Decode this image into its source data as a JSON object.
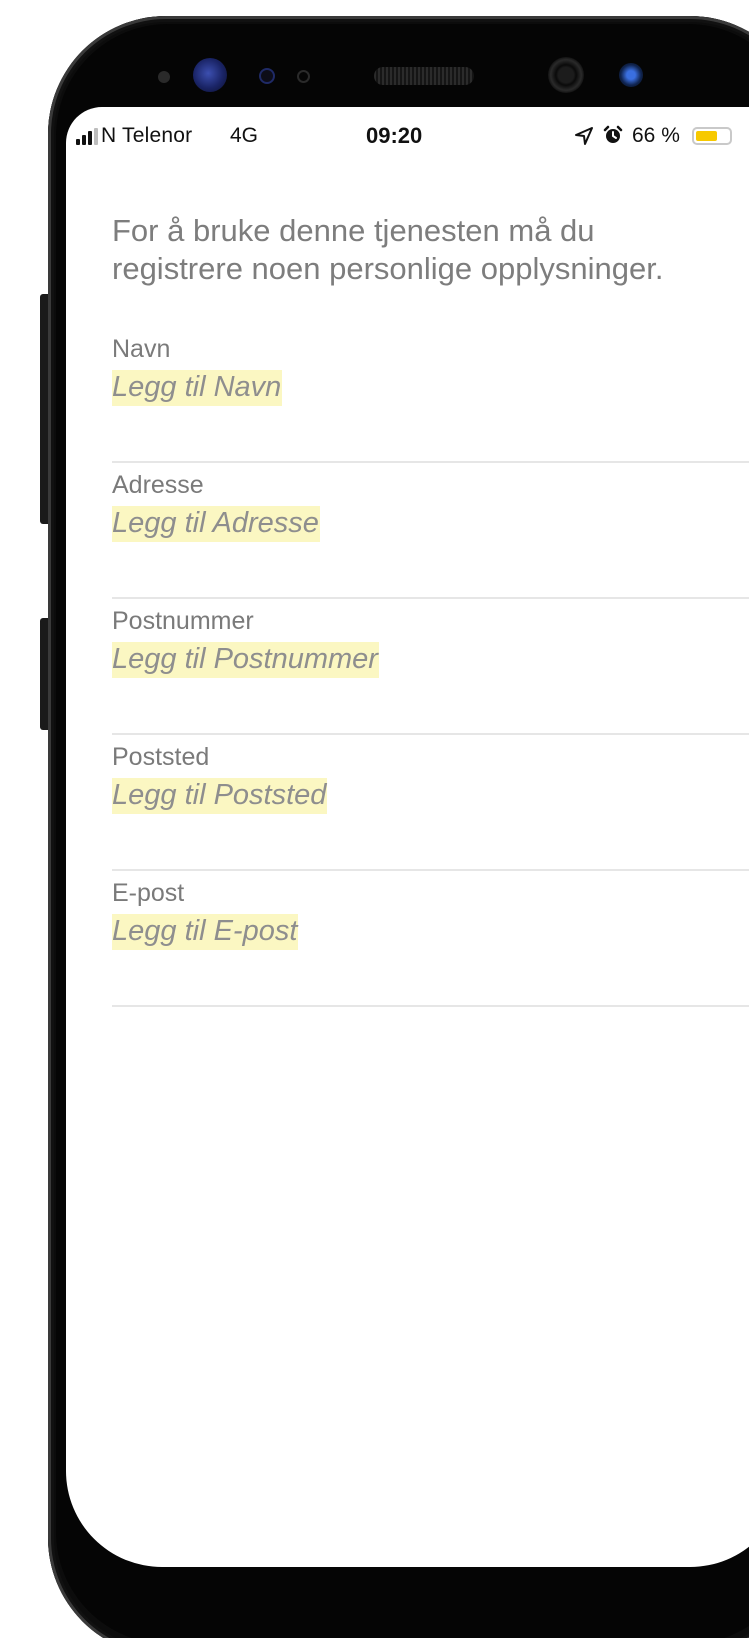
{
  "status_bar": {
    "carrier": "N Telenor",
    "network": "4G",
    "time": "09:20",
    "battery_percent": "66 %",
    "battery_level": 0.66,
    "icons": [
      "signal-icon",
      "location-arrow-icon",
      "alarm-clock-icon",
      "battery-icon"
    ]
  },
  "intro_text": "For å bruke denne tjenesten må du registrere noen personlige opplysninger.",
  "fields": [
    {
      "label": "Navn",
      "value": "Legg til Navn"
    },
    {
      "label": "Adresse",
      "value": "Legg til Adresse"
    },
    {
      "label": "Postnummer",
      "value": "Legg til Postnummer"
    },
    {
      "label": "Poststed",
      "value": "Legg til Poststed"
    },
    {
      "label": "E-post",
      "value": "Legg til E-post"
    }
  ],
  "colors": {
    "highlight": "#fbf7c2",
    "battery_fill": "#f7c900",
    "muted_text": "#7d7d7d"
  }
}
